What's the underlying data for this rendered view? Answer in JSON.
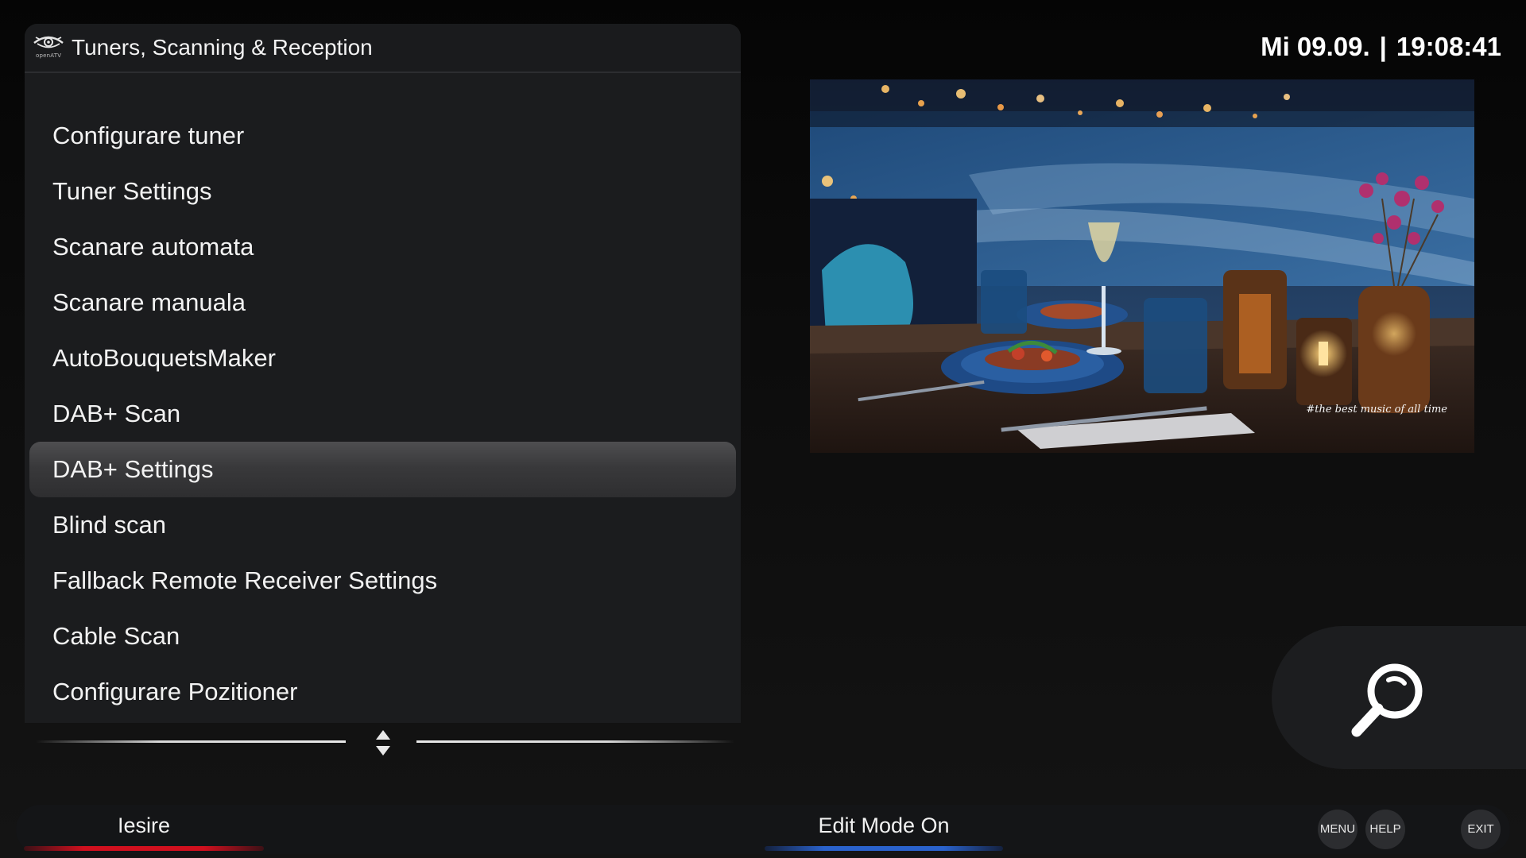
{
  "header": {
    "title": "Tuners, Scanning & Reception",
    "logo_text": "openATV"
  },
  "menu": {
    "items": [
      {
        "label": "Configurare tuner",
        "selected": false
      },
      {
        "label": "Tuner Settings",
        "selected": false
      },
      {
        "label": "Scanare automata",
        "selected": false
      },
      {
        "label": "Scanare manuala",
        "selected": false
      },
      {
        "label": "AutoBouquetsMaker",
        "selected": false
      },
      {
        "label": "DAB+ Scan",
        "selected": false
      },
      {
        "label": "DAB+ Settings",
        "selected": true
      },
      {
        "label": "Blind scan",
        "selected": false
      },
      {
        "label": "Fallback Remote Receiver Settings",
        "selected": false
      },
      {
        "label": "Cable Scan",
        "selected": false
      },
      {
        "label": "Configurare Pozitioner",
        "selected": false
      }
    ]
  },
  "clock": {
    "date": "Mi 09.09.",
    "separator": "|",
    "time": "19:08:41"
  },
  "preview": {
    "caption": "#the best music of all time"
  },
  "search": {
    "icon": "search-icon"
  },
  "footer": {
    "red_label": "Iesire",
    "blue_label": "Edit Mode On",
    "menu_key": "MENU",
    "help_key": "HELP",
    "exit_key": "EXIT"
  },
  "colors": {
    "red": "#d0101e",
    "blue": "#2a62cc",
    "selection": "#444446",
    "panel": "#1b1c1e"
  }
}
